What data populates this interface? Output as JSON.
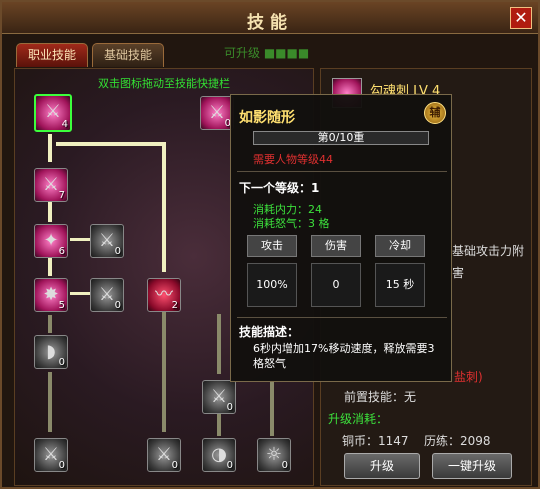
{
  "window": {
    "title": "技能",
    "close": "✕"
  },
  "tabs": [
    {
      "label": "职业技能"
    },
    {
      "label": "基础技能"
    }
  ],
  "overlay_text": "可升级 ■■■■",
  "tree": {
    "hint": "双击图标拖动至技能快捷栏",
    "slots": [
      {
        "glyph": "⚔",
        "count": "4"
      },
      {
        "glyph": "⚔",
        "count": "7"
      },
      {
        "glyph": "✦",
        "count": "6"
      },
      {
        "glyph": "⚔",
        "count": "0"
      },
      {
        "glyph": "✸",
        "count": "5"
      },
      {
        "glyph": "⚔",
        "count": "0"
      },
      {
        "glyph": "〰",
        "count": "2"
      },
      {
        "glyph": "◗",
        "count": "0"
      },
      {
        "glyph": "⚔",
        "count": "0"
      },
      {
        "glyph": "◑",
        "count": "0"
      },
      {
        "glyph": "☼",
        "count": "0"
      },
      {
        "glyph": "⚔",
        "count": "0"
      },
      {
        "glyph": "⚔",
        "count": "0"
      },
      {
        "glyph": "⚔",
        "count": "0"
      }
    ]
  },
  "info": {
    "skill_name": "勾魂刺 LV 4",
    "desc_fragment_1": "基础攻击力附",
    "desc_fragment_2": "害",
    "red_fragment": "盐刺)",
    "prereq": "前置技能：无",
    "upgrade_cost_label": "升级消耗：",
    "copper": "铜币：1147",
    "experience": "历练：2098",
    "upgrade_btn": "升级",
    "one_key_btn": "一键升级"
  },
  "tooltip": {
    "title": "如影随形",
    "badge": "辅",
    "progress": "第0/10重",
    "required": "需要人物等级44",
    "next_level": "下一个等级：1",
    "mp_cost": "消耗内力：24",
    "rage_cost": "消耗怒气：3 格",
    "attack_label": "攻击",
    "attack_value": "100%",
    "damage_label": "伤害",
    "damage_value": "0",
    "cooldown_label": "冷却",
    "cooldown_value": "15 秒",
    "desc_heading": "技能描述：",
    "desc": "6秒内增加17%移动速度，释放需要3格怒气"
  }
}
